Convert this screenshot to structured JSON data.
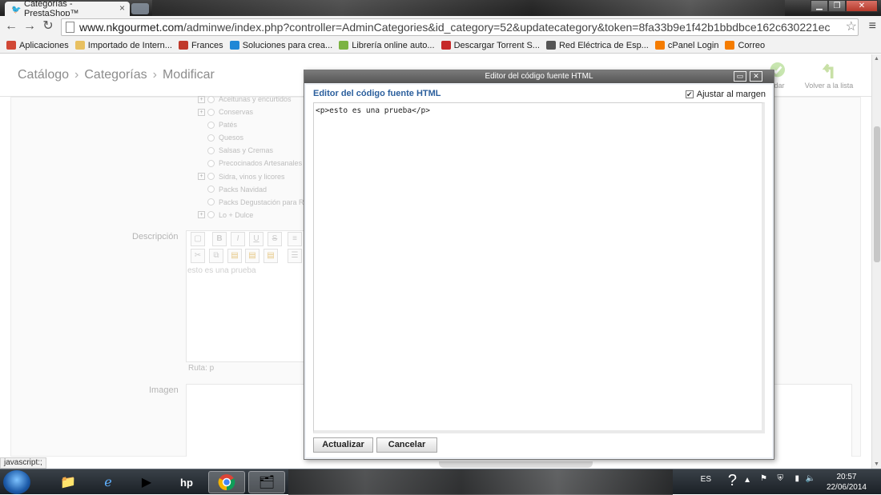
{
  "browser": {
    "tab_title": "Categorías - PrestaShop™",
    "tab_close": "×",
    "url_domain": "www.nkgourmet.com",
    "url_path": "/adminwe/index.php?controller=AdminCategories&id_category=52&updatecategory&token=8fa33b9e1f42b1bbdbce162c630221ec",
    "window_controls": {
      "minimize": "▁",
      "maximize": "❐",
      "close": "✕"
    },
    "back": "←",
    "forward": "→",
    "reload": "↻",
    "star": "☆",
    "menu": "≡"
  },
  "bookmarks": [
    {
      "label": "Aplicaciones",
      "icon": "apps-grid-icon",
      "color": "#d14836"
    },
    {
      "label": "Importado de Intern...",
      "icon": "folder-icon",
      "color": "#e8c060"
    },
    {
      "label": "Frances",
      "icon": "frances-icon",
      "color": "#c0392b"
    },
    {
      "label": "Soluciones para crea...",
      "icon": "ja-icon",
      "color": "#1f87d6"
    },
    {
      "label": "Librería online auto...",
      "icon": "android-icon",
      "color": "#7cb342"
    },
    {
      "label": "Descargar Torrent S...",
      "icon": "torrent-icon",
      "color": "#c62828"
    },
    {
      "label": "Red Eléctrica de Esp...",
      "icon": "red-electrica-icon",
      "color": "#555555"
    },
    {
      "label": "cPanel Login",
      "icon": "cpanel-icon",
      "color": "#f57c00"
    },
    {
      "label": "Correo",
      "icon": "cpanel-icon",
      "color": "#f57c00"
    }
  ],
  "page": {
    "breadcrumb": [
      "Catálogo",
      "Categorías",
      "Modificar"
    ],
    "breadcrumb_sep": "›",
    "toolbar": {
      "save": "ardar",
      "back_to_list": "Volver a la lista"
    },
    "tree": [
      {
        "label": "Aceitunas y encurtidos",
        "expandable": true
      },
      {
        "label": "Conservas",
        "expandable": true
      },
      {
        "label": "Patés",
        "expandable": false
      },
      {
        "label": "Quesos",
        "expandable": false
      },
      {
        "label": "Salsas y Cremas",
        "expandable": false
      },
      {
        "label": "Precocinados Artesanales",
        "expandable": false
      },
      {
        "label": "Sidra, vinos y licores",
        "expandable": true
      },
      {
        "label": "Packs Navidad",
        "expandable": false
      },
      {
        "label": "Packs Degustación para Re",
        "expandable": false
      },
      {
        "label": "Lo + Dulce",
        "expandable": true
      }
    ],
    "description_label": "Descripción",
    "description_text": "esto es una prueba",
    "ruta": "Ruta: p",
    "image_label": "Imagen",
    "status_bar": "javascript:;"
  },
  "modal": {
    "title": "Editor del código fuente HTML",
    "heading": "Editor del código fuente HTML",
    "wrap_label": "Ajustar al margen",
    "wrap_checked": "✔",
    "code": "<p>esto es una prueba</p>",
    "update_button": "Actualizar",
    "cancel_button": "Cancelar",
    "ctl_maximize": "▭",
    "ctl_close": "✕"
  },
  "taskbar": {
    "language": "ES",
    "time": "20:57",
    "date": "22/06/2014"
  },
  "colors": {
    "accent_heading": "#2b5f9d",
    "modal_title_bg": "#5e5e5e"
  }
}
